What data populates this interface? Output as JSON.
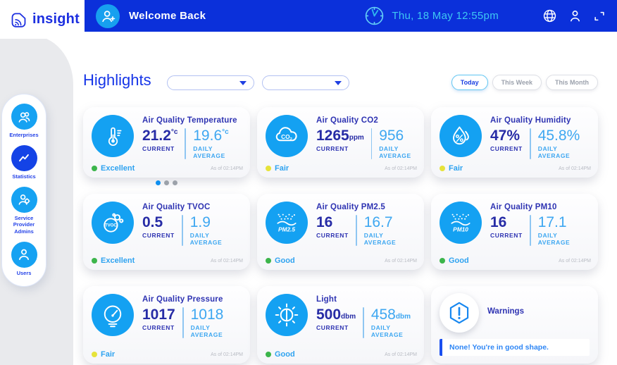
{
  "app": {
    "logo_text": "insight"
  },
  "header": {
    "welcome_text": "Welcome Back",
    "datetime_text": "Thu, 18 May 12:55pm"
  },
  "sidebar": {
    "items": [
      {
        "label": "Enterprises",
        "icon": "enterprises-icon",
        "selected": false
      },
      {
        "label": "Statistics",
        "icon": "statistics-icon",
        "selected": true
      },
      {
        "label": "Service Provider Admins",
        "icon": "service-provider-admins-icon",
        "selected": false
      },
      {
        "label": "Users",
        "icon": "users-icon",
        "selected": false
      }
    ]
  },
  "main": {
    "title": "Highlights",
    "range_tabs": [
      {
        "label": "Today",
        "active": true
      },
      {
        "label": "This Week",
        "active": false
      },
      {
        "label": "This Month",
        "active": false
      }
    ]
  },
  "cards": [
    {
      "icon": "thermometer-icon",
      "title": "Air Quality Temperature",
      "current_value": "21.2",
      "current_unit": "°c",
      "avg_value": "19.6",
      "avg_unit": "°c",
      "unit_pos": "sup",
      "current_label": "CURRENT",
      "avg_label": "DAILY AVERAGE",
      "status": "Excellent",
      "dot_color": "#3CB54B",
      "as_of": "As of 02:14PM"
    },
    {
      "icon": "co2-icon",
      "title": "Air Quality CO2",
      "current_value": "1265",
      "current_unit": "ppm",
      "avg_value": "956",
      "avg_unit": "",
      "unit_pos": "sub",
      "current_label": "CURRENT",
      "avg_label": "DAILY AVERAGE",
      "status": "Fair",
      "dot_color": "#E6E33A",
      "as_of": "As of 02:14PM"
    },
    {
      "icon": "humidity-icon",
      "title": "Air Quality Humidity",
      "current_value": "47%",
      "current_unit": "",
      "avg_value": "45.8%",
      "avg_unit": "",
      "unit_pos": "none",
      "current_label": "CURRENT",
      "avg_label": "DAILY AVERAGE",
      "status": "Fair",
      "dot_color": "#E6E33A",
      "as_of": "As of 02:14PM"
    },
    {
      "icon": "tvoc-icon",
      "title": "Air Quality TVOC",
      "current_value": "0.5",
      "current_unit": "",
      "avg_value": "1.9",
      "avg_unit": "",
      "unit_pos": "none",
      "current_label": "CURRENT",
      "avg_label": "DAILY AVERAGE",
      "status": "Excellent",
      "dot_color": "#3CB54B",
      "as_of": "As of 02:14PM"
    },
    {
      "icon": "pm25-icon",
      "title": "Air Quality PM2.5",
      "current_value": "16",
      "current_unit": "",
      "avg_value": "16.7",
      "avg_unit": "",
      "unit_pos": "none",
      "current_label": "CURRENT",
      "avg_label": "DAILY AVERAGE",
      "status": "Good",
      "dot_color": "#3CB54B",
      "as_of": "As of 02:14PM"
    },
    {
      "icon": "pm10-icon",
      "title": "Air Quality PM10",
      "current_value": "16",
      "current_unit": "",
      "avg_value": "17.1",
      "avg_unit": "",
      "unit_pos": "none",
      "current_label": "CURRENT",
      "avg_label": "DAILY AVERAGE",
      "status": "Good",
      "dot_color": "#3CB54B",
      "as_of": "As of 02:14PM"
    },
    {
      "icon": "pressure-icon",
      "title": "Air Quality Pressure",
      "current_value": "1017",
      "current_unit": "",
      "avg_value": "1018",
      "avg_unit": "",
      "unit_pos": "none",
      "current_label": "CURRENT",
      "avg_label": "DAILY AVERAGE",
      "status": "Fair",
      "dot_color": "#E6E33A",
      "as_of": "As of 02:14PM"
    },
    {
      "icon": "light-icon",
      "title": "Light",
      "current_value": "500",
      "current_unit": "dbm",
      "avg_value": "458",
      "avg_unit": "dbm",
      "unit_pos": "sub",
      "current_label": "CURRENT",
      "avg_label": "DAILY AVERAGE",
      "status": "Good",
      "dot_color": "#3CB54B",
      "as_of": "As of 02:14PM"
    }
  ],
  "warnings": {
    "title": "Warnings",
    "message": "None! You're in good shape."
  },
  "carousel": {
    "dot_count": 3,
    "active_index": 0
  },
  "colors": {
    "header_blue": "#0B30DA",
    "accent_azure": "#14A1F2",
    "royal_blue": "#1C2FE0",
    "value_indigo": "#272CA6",
    "avg_azure": "#3EA7F1",
    "status_green": "#3CB54B",
    "status_yellow": "#E6E33A",
    "datetime_cyan": "#3EC8F3",
    "rail_gray": "#E9EAED"
  }
}
